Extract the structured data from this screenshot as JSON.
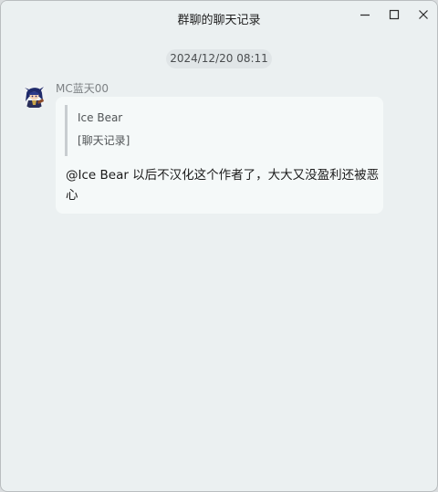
{
  "window": {
    "title": "群聊的聊天记录"
  },
  "controls": {
    "minimize_icon": "minimize-icon",
    "maximize_icon": "maximize-icon",
    "close_icon": "close-icon"
  },
  "chat": {
    "timestamp": "2024/12/20 08:11",
    "messages": [
      {
        "sender": "MC蓝天00",
        "avatar_icon": "avatar-character",
        "quote": {
          "author": "Ice Bear",
          "text": "[聊天记录]"
        },
        "text": "@Ice Bear 以后不汉化这个作者了，大大又没盈利还被恶心"
      }
    ]
  },
  "colors": {
    "background": "#ebf0f1",
    "bubble": "#f5f9f9",
    "timestamp_pill": "#e0e5e7",
    "quote_bar": "#c8cdd0"
  }
}
